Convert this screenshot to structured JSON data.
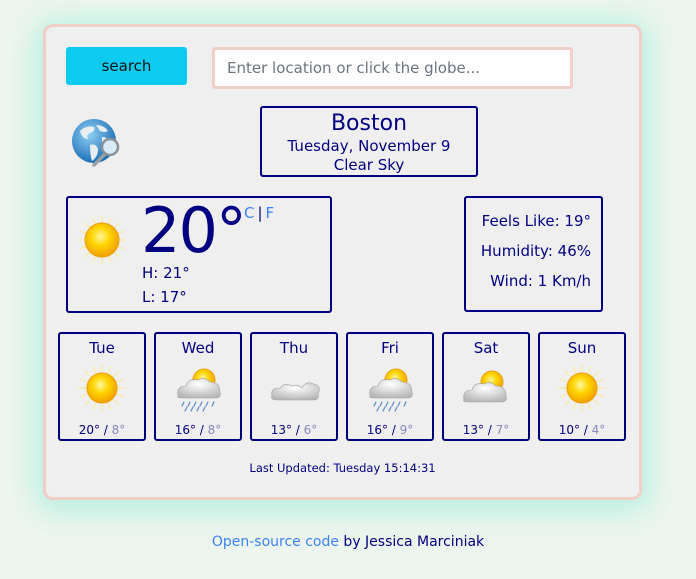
{
  "search": {
    "button_label": "search",
    "input_value": "",
    "placeholder": "Enter location or click the globe..."
  },
  "globe": {
    "icon": "globe-search-icon"
  },
  "location": {
    "city": "Boston",
    "date": "Tuesday, November 9",
    "description": "Clear Sky"
  },
  "current": {
    "icon": "sun-icon",
    "temp": "20°",
    "unit_c": "C",
    "unit_sep": "|",
    "unit_f": "F",
    "high": "H: 21°",
    "low": "L: 17°"
  },
  "details": {
    "feels_like": "Feels Like: 19°",
    "humidity": "Humidity: 46%",
    "wind": "Wind: 1 Km/h"
  },
  "forecast": [
    {
      "day": "Tue",
      "icon": "sun",
      "max": "20°",
      "sep": " / ",
      "min": "8°"
    },
    {
      "day": "Wed",
      "icon": "sun-cloud-rain",
      "max": "16°",
      "sep": " / ",
      "min": "8°"
    },
    {
      "day": "Thu",
      "icon": "cloud",
      "max": "13°",
      "sep": " / ",
      "min": "6°"
    },
    {
      "day": "Fri",
      "icon": "sun-cloud-rain",
      "max": "16°",
      "sep": " / ",
      "min": "9°"
    },
    {
      "day": "Sat",
      "icon": "sun-cloud",
      "max": "13°",
      "sep": " / ",
      "min": "7°"
    },
    {
      "day": "Sun",
      "icon": "sun",
      "max": "10°",
      "sep": " / ",
      "min": "4°"
    }
  ],
  "updated": "Last Updated: Tuesday 15:14:31",
  "footer": {
    "link_text": "Open-source code",
    "byline": " by Jessica Marciniak"
  },
  "colors": {
    "accent": "#0ccbef",
    "text": "#000080",
    "link": "#3b82f6",
    "card_border": "#efcfc8"
  }
}
